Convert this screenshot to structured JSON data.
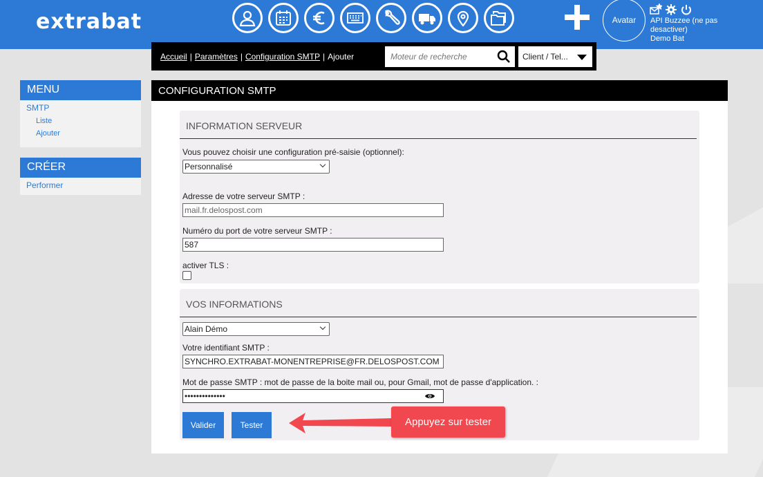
{
  "brand": {
    "logo": "extrabat"
  },
  "topbar": {
    "icons": [
      "user-icon",
      "calendar-icon",
      "euro-icon",
      "keyboard-icon",
      "wrench-icon",
      "truck-icon",
      "location-pin-icon",
      "folders-icon"
    ],
    "avatar_label": "Avatar",
    "user_name": "API Buzzee (ne pas desactiver)",
    "company": "Demo Bat"
  },
  "breadcrumb": {
    "items": [
      "Accueil",
      "Paramètres",
      "Configuration SMTP"
    ],
    "current": "Ajouter"
  },
  "search": {
    "placeholder": "Moteur de recherche"
  },
  "client_select": {
    "value": "Client / Tel..."
  },
  "sidebar": {
    "menu_title": "MENU",
    "menu_link": "SMTP",
    "sub_items": [
      "Liste",
      "Ajouter"
    ],
    "create_title": "CRÉER",
    "create_link": "Performer"
  },
  "main": {
    "title": "CONFIGURATION SMTP",
    "server_section": {
      "title": "INFORMATION SERVEUR",
      "preset_label": "Vous pouvez choisir une configuration pré-saisie (optionnel):",
      "preset_value": "Personnalisé",
      "server_label": "Adresse de votre serveur SMTP :",
      "server_value": "mail.fr.delospost.com",
      "port_label": "Numéro du port de votre serveur SMTP :",
      "port_value": "587",
      "tls_label": "activer TLS :"
    },
    "user_section": {
      "title": "VOS INFORMATIONS",
      "user_value": "Alain Démo",
      "login_label": "Votre identifiant SMTP :",
      "login_value": "SYNCHRO.EXTRABAT-MONENTREPRISE@FR.DELOSPOST.COM",
      "password_label": "Mot de passe SMTP : mot de passe de la boite mail ou, pour Gmail, mot de passe d'application. :",
      "password_value": "••••••••••••••"
    },
    "validate_button": "Valider",
    "test_button": "Tester"
  },
  "callout": {
    "text": "Appuyez sur tester"
  },
  "colors": {
    "brand_blue": "#2d7ad6",
    "callout_red": "#f1474e"
  }
}
